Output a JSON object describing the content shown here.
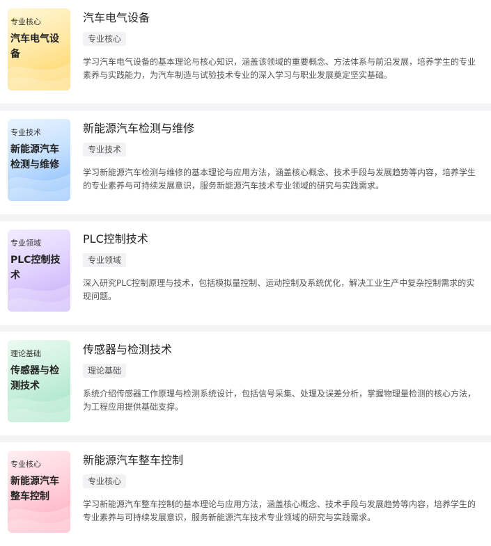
{
  "courses": [
    {
      "cover_category": "专业核心",
      "cover_title": "汽车电气设备",
      "title": "汽车电气设备",
      "tag": "专业核心",
      "description": "学习汽车电气设备的基本理论与核心知识，涵盖该领域的重要概念、方法体系与前沿发展，培养学生的专业素养与实践能力，为汽车制造与试验技术专业的深入学习与职业发展奠定坚实基础。",
      "color": "#ffd35e"
    },
    {
      "cover_category": "专业技术",
      "cover_title": "新能源汽车检测与维修",
      "title": "新能源汽车检测与维修",
      "tag": "专业技术",
      "description": "学习新能源汽车检测与维修的基本理论与应用方法，涵盖核心概念、技术手段与发展趋势等内容，培养学生的专业素养与可持续发展意识，服务新能源汽车技术专业领域的研究与实践需求。",
      "color": "#7fb8fa"
    },
    {
      "cover_category": "专业领域",
      "cover_title": "PLC控制技术",
      "title": "PLC控制技术",
      "tag": "专业领域",
      "description": "深入研究PLC控制原理与技术，包括模拟量控制、运动控制及系统优化，解决工业生产中复杂控制需求的实现问题。",
      "color": "#c4a9f7"
    },
    {
      "cover_category": "理论基础",
      "cover_title": "传感器与检测技术",
      "title": "传感器与检测技术",
      "tag": "理论基础",
      "description": "系统介绍传感器工作原理与检测系统设计，包括信号采集、处理及误差分析，掌握物理量检测的核心方法，为工程应用提供基础支撑。",
      "color": "#9fe2c2"
    },
    {
      "cover_category": "专业核心",
      "cover_title": "新能源汽车整车控制",
      "title": "新能源汽车整车控制",
      "tag": "专业核心",
      "description": "学习新能源汽车整车控制的基本理论与应用方法，涵盖核心概念、技术手段与发展趋势等内容，培养学生的专业素养与可持续发展意识，服务新能源汽车技术专业领域的研究与实践需求。",
      "color": "#ffa9bb"
    }
  ]
}
